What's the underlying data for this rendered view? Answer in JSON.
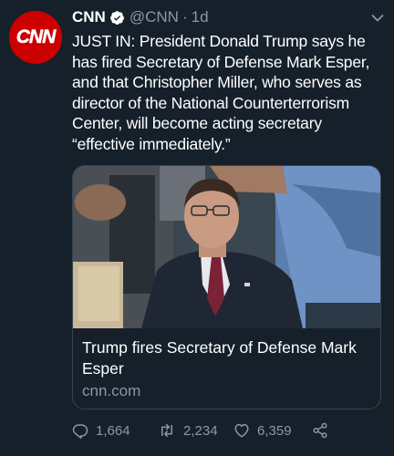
{
  "avatar": {
    "text": "CNN",
    "color": "#cc0000"
  },
  "tweet": {
    "author_name": "CNN",
    "handle": "@CNN",
    "separator": "·",
    "time": "1d",
    "text": "JUST IN: President Donald Trump says he has fired Secretary of Defense Mark Esper, and that Christopher Miller, who serves as director of the National Counterterrorism Center, will become acting secretary “effective immediately.”"
  },
  "card": {
    "title": "Trump fires Secretary of Defense Mark Esper",
    "domain": "cnn.com"
  },
  "actions": {
    "replies": "1,664",
    "retweets": "2,234",
    "likes": "6,359"
  },
  "colors": {
    "background": "#15202b",
    "text": "#ffffff",
    "secondary": "#8899a6",
    "border": "#38444d"
  },
  "icons": [
    "verified-badge-icon",
    "chevron-down-icon",
    "reply-icon",
    "retweet-icon",
    "like-icon",
    "share-icon"
  ]
}
